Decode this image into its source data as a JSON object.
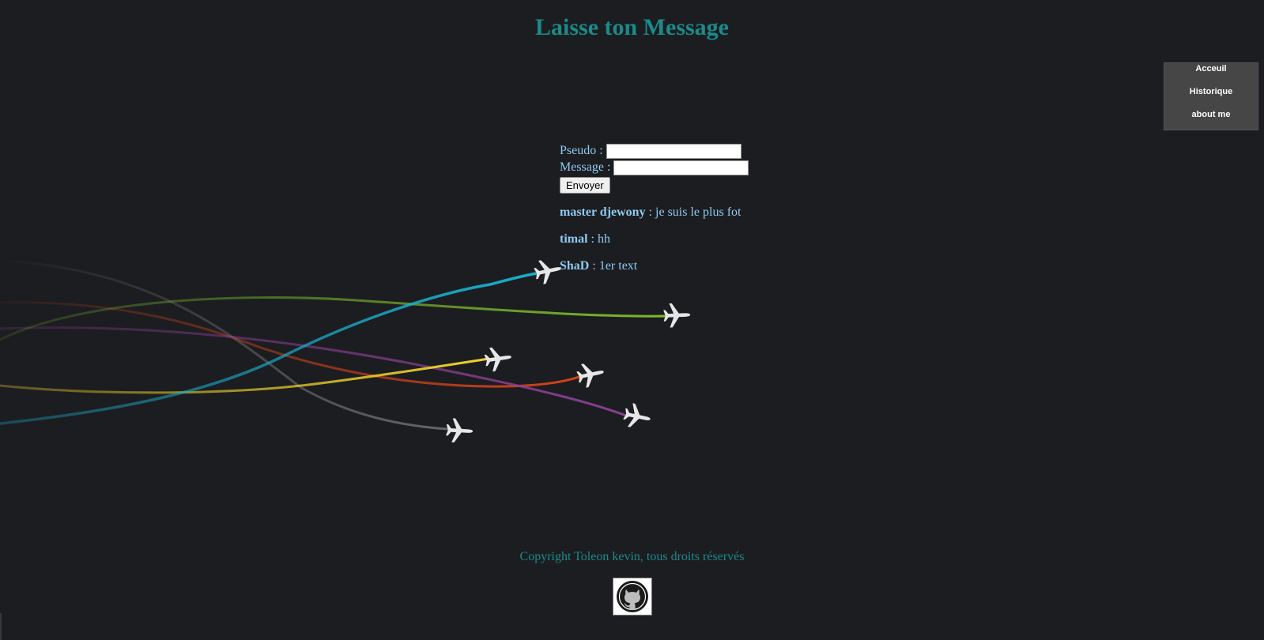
{
  "page": {
    "title": "Laisse ton Message"
  },
  "nav": {
    "items": [
      {
        "label": "Acceuil"
      },
      {
        "label": "Historique"
      },
      {
        "label": "about me"
      }
    ]
  },
  "form": {
    "pseudo_label": "Pseudo :",
    "pseudo_value": "",
    "message_label": "Message :",
    "message_value": "",
    "submit_label": "Envoyer"
  },
  "messages": [
    {
      "author": "master djewony",
      "separator": " : ",
      "text": "je suis le plus fot"
    },
    {
      "author": "timal",
      "separator": " : ",
      "text": "hh"
    },
    {
      "author": "ShaD",
      "separator": " : ",
      "text": "1er text"
    }
  ],
  "decoration": {
    "flight_colors": [
      "#1ab0cf",
      "#7dbb2c",
      "#f0d42a",
      "#d6441a",
      "#8a3f93",
      "#66676b"
    ],
    "icon": "airplane-icon"
  },
  "footer": {
    "copyright": "Copyright Toleon kevin, tous droits réservés",
    "github_icon": "github-icon"
  }
}
